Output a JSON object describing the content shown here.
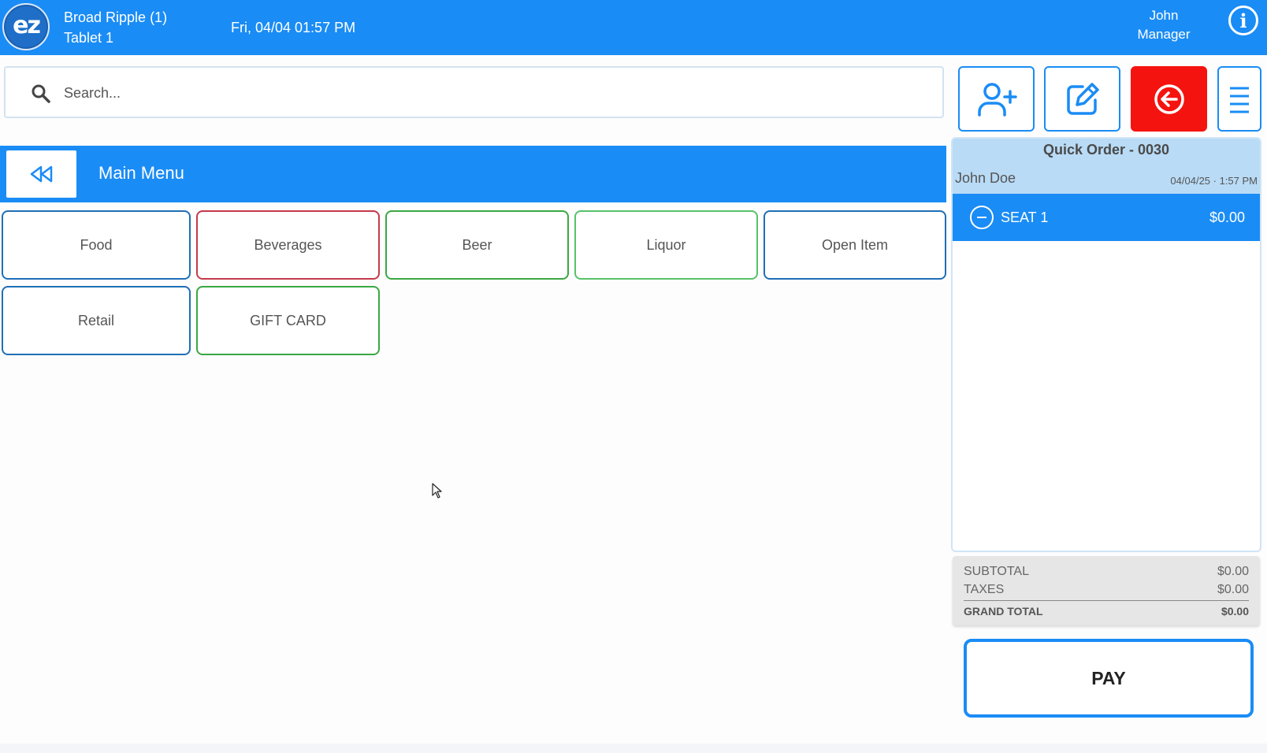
{
  "header": {
    "logo_text": "ez",
    "location_name": "Broad Ripple (1)",
    "device_name": "Tablet 1",
    "datetime": "Fri, 04/04 01:57 PM",
    "user_name": "John",
    "user_role": "Manager",
    "info_icon": "info-icon",
    "info_glyph": "i"
  },
  "search": {
    "placeholder": "Search..."
  },
  "toolbar": {
    "buttons": [
      "add-customer-icon",
      "edit-icon",
      "back-arrow-icon",
      "menu-icon"
    ],
    "red_color": "#f5130f",
    "accent_color": "#1a8cf5"
  },
  "menu": {
    "title": "Main Menu",
    "categories": [
      {
        "label": "Food",
        "color": "#1f6fb6"
      },
      {
        "label": "Beverages",
        "color": "#c63a4a"
      },
      {
        "label": "Beer",
        "color": "#3aa843"
      },
      {
        "label": "Liquor",
        "color": "#58c16a"
      },
      {
        "label": "Open Item",
        "color": "#1f6fb6"
      },
      {
        "label": "Retail",
        "color": "#1f6fb6"
      },
      {
        "label": "GIFT CARD",
        "color": "#3aa843"
      }
    ]
  },
  "order": {
    "title": "Quick Order - 0030",
    "customer": "John Doe",
    "timestamp": "04/04/25 · 1:57 PM",
    "seat": {
      "label": "SEAT 1",
      "amount": "$0.00"
    }
  },
  "totals": {
    "subtotal_label": "SUBTOTAL",
    "subtotal": "$0.00",
    "taxes_label": "TAXES",
    "taxes": "$0.00",
    "grand_label": "GRAND TOTAL",
    "grand": "$0.00"
  },
  "pay_label": "PAY"
}
